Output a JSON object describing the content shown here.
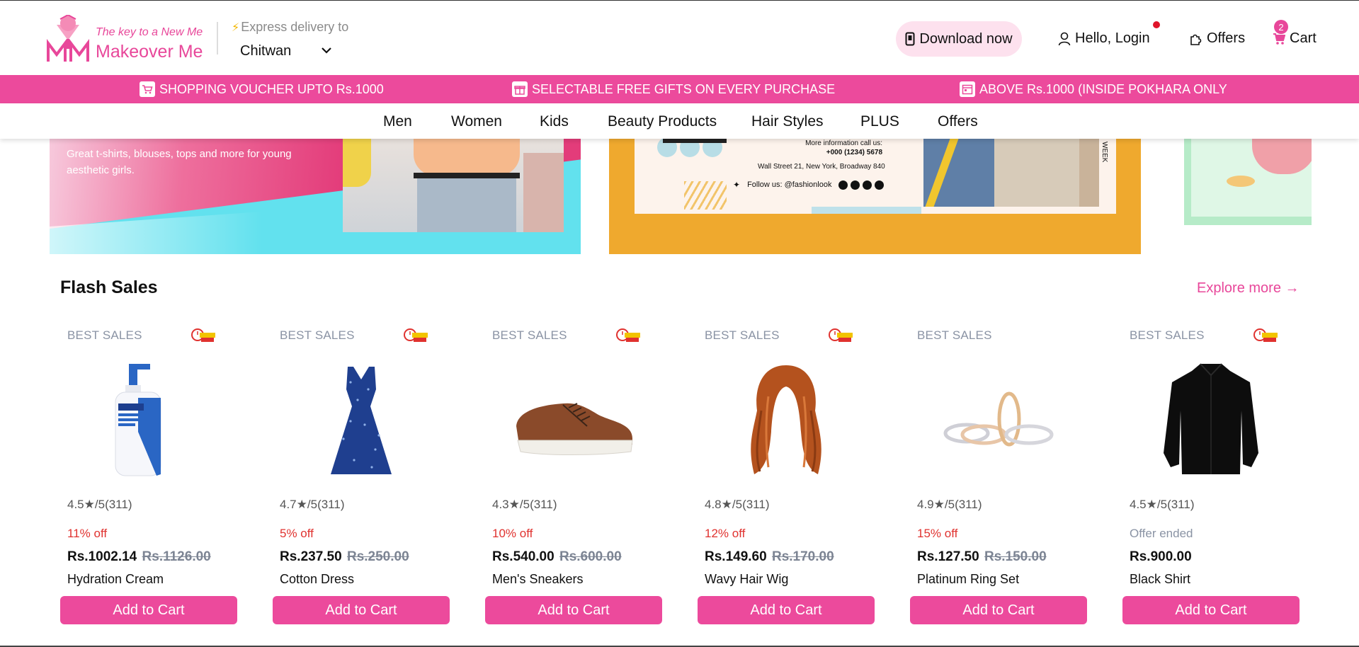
{
  "brand": {
    "tagline": "The key to a New Me",
    "name": "Makeover Me"
  },
  "delivery": {
    "label": "Express delivery to",
    "city": "Chitwan"
  },
  "header": {
    "download_label": "Download now",
    "login_label": "Hello, Login",
    "offers_label": "Offers",
    "cart_label": "Cart",
    "cart_count": "2"
  },
  "promo": [
    {
      "icon": "cart-icon",
      "text": "SHOPPING VOUCHER UPTO Rs.1000"
    },
    {
      "icon": "gift-icon",
      "text": "SELECTABLE FREE GIFTS ON EVERY PURCHASE"
    },
    {
      "icon": "calendar-icon",
      "text": "ABOVE Rs.1000 (INSIDE POKHARA ONLY"
    }
  ],
  "categories": [
    "Men",
    "Women",
    "Kids",
    "Beauty Products",
    "Hair Styles",
    "PLUS",
    "Offers"
  ],
  "banners": {
    "left_text": "Great t-shirts, blouses, tops and more for young aesthetic girls.",
    "middle_info_line1": "More information call us:",
    "middle_info_line2": "+000 (1234) 5678",
    "middle_address": "Wall Street 21, New York, Broadway 840",
    "middle_follow": "Follow us: @fashionlook",
    "middle_side": "WEEK"
  },
  "flash": {
    "title": "Flash Sales",
    "explore": "Explore more →"
  },
  "products": [
    {
      "tag": "BEST SALES",
      "rating": "4.5",
      "rating_suffix": "/5(311)",
      "discount": "11% off",
      "price": "Rs.1002.14",
      "old_price": "Rs.1126.00",
      "name": "Hydration Cream",
      "button": "Add to Cart"
    },
    {
      "tag": "BEST SALES",
      "rating": "4.7",
      "rating_suffix": "/5(311)",
      "discount": "5% off",
      "price": "Rs.237.50",
      "old_price": "Rs.250.00",
      "name": "Cotton Dress",
      "button": "Add to Cart"
    },
    {
      "tag": "BEST SALES",
      "rating": "4.3",
      "rating_suffix": "/5(311)",
      "discount": "10% off",
      "price": "Rs.540.00",
      "old_price": "Rs.600.00",
      "name": "Men's Sneakers",
      "button": "Add to Cart"
    },
    {
      "tag": "BEST SALES",
      "rating": "4.8",
      "rating_suffix": "/5(311)",
      "discount": "12% off",
      "price": "Rs.149.60",
      "old_price": "Rs.170.00",
      "name": "Wavy Hair Wig",
      "button": "Add to Cart"
    },
    {
      "tag": "BEST SALES",
      "rating": "4.9",
      "rating_suffix": "/5(311)",
      "discount": "15% off",
      "price": "Rs.127.50",
      "old_price": "Rs.150.00",
      "name": "Platinum Ring Set",
      "button": "Add to Cart"
    },
    {
      "tag": "BEST SALES",
      "rating": "4.5",
      "rating_suffix": "/5(311)",
      "discount": "Offer ended",
      "price": "Rs.900.00",
      "old_price": "",
      "name": "Black Shirt",
      "button": "Add to Cart"
    }
  ],
  "colors": {
    "accent": "#ec4a9c",
    "discount": "#e0322f",
    "muted": "#8a93a4"
  }
}
